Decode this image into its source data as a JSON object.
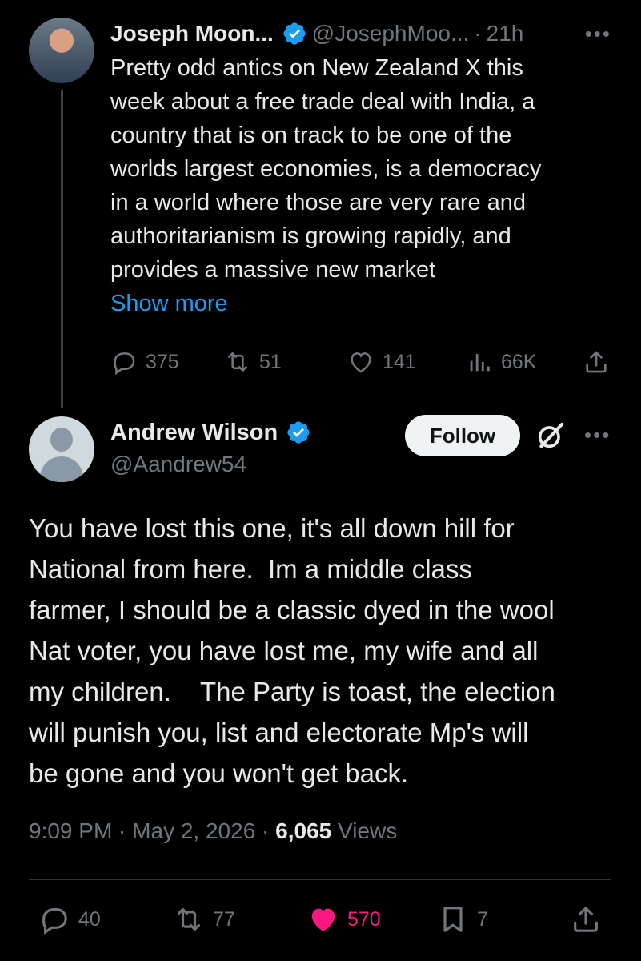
{
  "parent_tweet": {
    "author_name": "Joseph Moon...",
    "handle": "@JosephMoo...",
    "separator": "·",
    "time_ago": "21h",
    "more": "•••",
    "body": "Pretty odd antics on New Zealand X this\nweek about a free trade deal with India, a\ncountry that is on track to be one of the\nworlds largest economies, is a democracy\nin a world where those are very rare and\nauthoritarianism is growing rapidly, and\nprovides a massive new market",
    "show_more": "Show more",
    "replies": "375",
    "reposts": "51",
    "likes": "141",
    "views": "66K"
  },
  "reply_tweet": {
    "author_name": "Andrew Wilson",
    "handle": "@Aandrew54",
    "follow_label": "Follow",
    "more": "•••",
    "body": "You have lost this one, it's all down hill for\nNational from here.  Im a middle class\nfarmer, I should be a classic dyed in the wool\nNat voter, you have lost me, my wife and all\nmy children.    The Party is toast, the election\nwill punish you, list and electorate Mp's will\nbe gone and you won't get back.",
    "time": "9:09 PM",
    "sep1": " · ",
    "date": "May 2, 2026",
    "sep2": " · ",
    "views_count": "6,065",
    "views_label": " Views",
    "replies": "40",
    "reposts": "77",
    "likes": "570",
    "bookmarks": "7"
  },
  "colors": {
    "background": "#000000",
    "text": "#e7e9ea",
    "muted": "#71767b",
    "link": "#1d9bf0",
    "verified": "#1d9bf0",
    "like_active": "#f91880"
  }
}
